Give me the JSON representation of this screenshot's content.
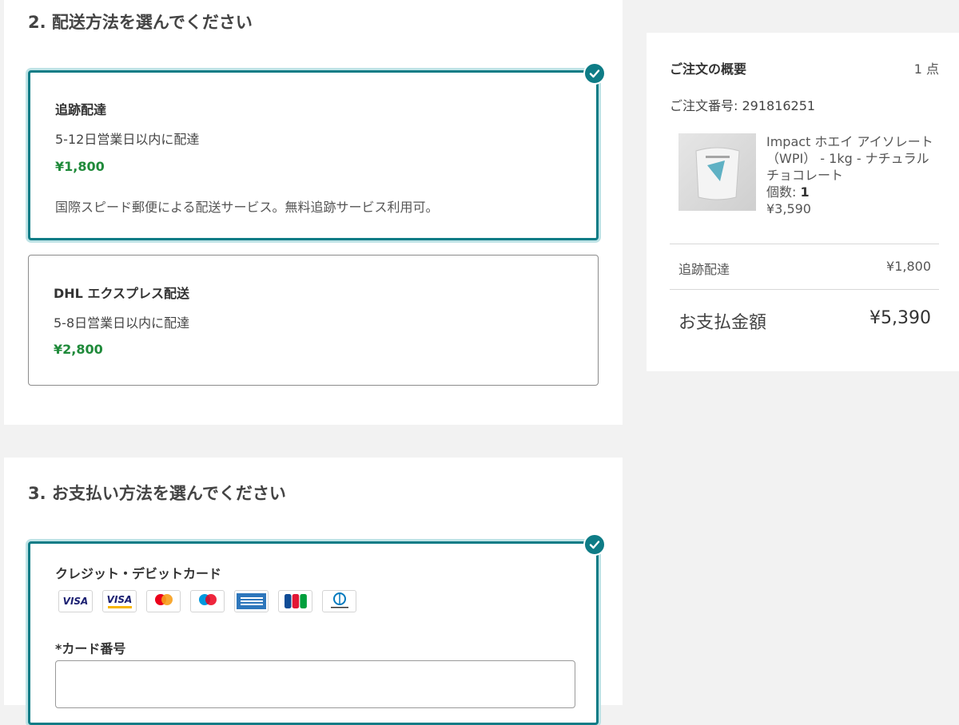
{
  "shipping": {
    "title": "2. 配送方法を選んでください",
    "options": [
      {
        "title": "追跡配達",
        "eta": "5-12日営業日以内に配達",
        "price": "¥1,800",
        "description": "国際スピード郵便による配送サービス。無料追跡サービス利用可。",
        "selected": true
      },
      {
        "title": "DHL エクスプレス配送",
        "eta": "5-8日営業日以内に配達",
        "price": "¥2,800",
        "selected": false
      }
    ]
  },
  "payment": {
    "title": "3. お支払い方法を選んでください",
    "method": {
      "title": "クレジット・デビットカード",
      "selected": true,
      "brands": [
        "VISA",
        "VISA",
        "mastercard",
        "maestro",
        "AMERICAN EXPRESS",
        "JCB",
        "Diners Club INTERNATIONAL"
      ]
    },
    "card_number_label": "*カード番号",
    "card_number_value": ""
  },
  "summary": {
    "title": "ご注文の概要",
    "count": "1 点",
    "order_number": "ご注文番号:  291816251",
    "product": {
      "name": "Impact ホエイ アイソレート （WPI） - 1kg - ナチュラルチョコレート",
      "qty_label": "個数:",
      "qty": "1",
      "price": "¥3,590"
    },
    "shipping_label": "追跡配達",
    "shipping_price": "¥1,800",
    "total_label": "お支払金額",
    "total_price": "¥5,390"
  },
  "colors": {
    "accent": "#0e7c86",
    "price_green": "#1f8a3a",
    "background": "#f2f2f2"
  }
}
